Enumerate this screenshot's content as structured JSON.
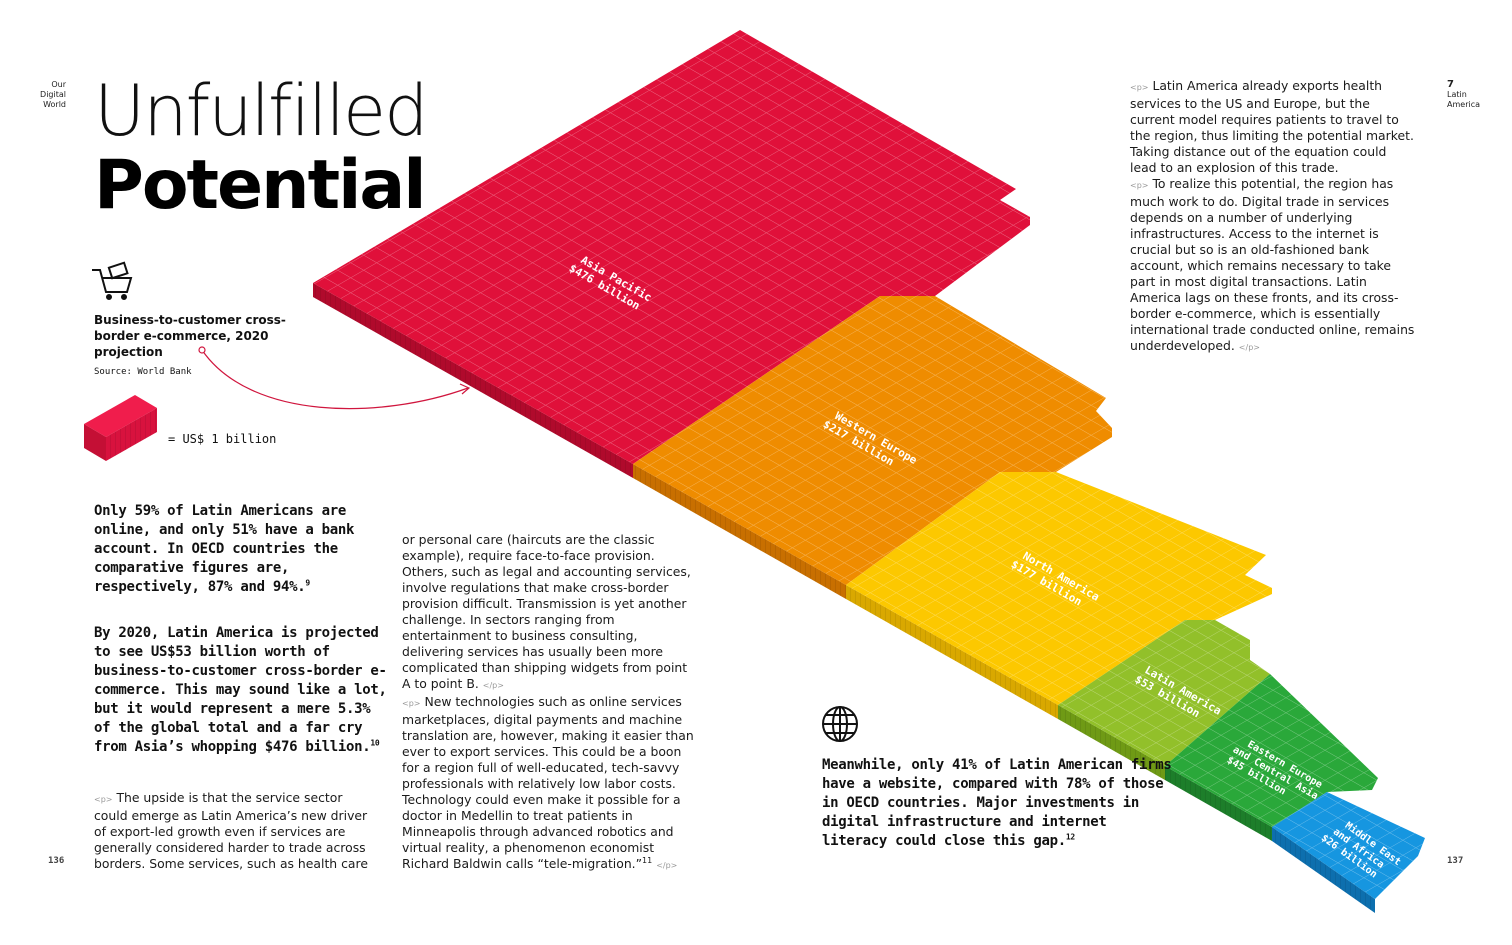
{
  "header": {
    "left_label": "Our\nDigital\nWorld",
    "right_number": "7",
    "right_label": "Latin\nAmerica"
  },
  "title": {
    "line1": "Unfulfilled",
    "line2": "Potential"
  },
  "chart_caption": {
    "title": "Business-to-customer cross-border e-commerce, 2020 projection",
    "source": "Source: World Bank",
    "legend": "= US$ 1 billion"
  },
  "callouts": {
    "c1": "Only 59% of Latin Americans are online, and only 51% have a bank account. In OECD countries the comparative figures are, respectively, 87% and 94%.",
    "c1_ref": "9",
    "c2": "By 2020, Latin America is projected to see US$53 billion worth of business-to-customer cross-border e-commerce. This may sound like a lot, but it would represent a mere 5.3% of the global total and a far cry from Asia’s whopping $476 billion.",
    "c2_ref": "10",
    "c3": "Meanwhile, only 41% of Latin American firms have a website, compared with 78% of those in OECD countries. Major investments in digital infrastructure and internet literacy could close this gap.",
    "c3_ref": "12"
  },
  "body": {
    "open_tag": "<p>",
    "close_tag": "</p>",
    "col1": "The upside is that the service sector could emerge as Latin America’s new driver of export-led growth even if services are generally considered harder to trade across borders. Some services, such as health care",
    "col2_p1": "or personal care (haircuts are the classic example), require face-to-face provision. Others, such as legal and accounting services, involve regulations that make cross-border provision difficult. Transmission is yet another challenge. In sectors ranging from entertainment to business consulting, delivering services has usually been more complicated than shipping widgets from point A to point B.",
    "col2_p2": "New technologies such as online services marketplaces, digital payments and machine translation are, however, making it easier than ever to export services. This could be a boon for a region full of well-educated, tech-savvy professionals with relatively low labor costs. Technology could even make it possible for a doctor in Medellin to treat patients in Minneapolis through advanced robotics and virtual reality, a phenomenon economist Richard Baldwin calls “tele-migration.”",
    "col2_ref": "11",
    "col3_p1": "Latin America already exports health services to the US and Europe, but the current model requires patients to travel to the region, thus limiting the potential market. Taking distance out of the equation could lead to an explosion of this trade.",
    "col3_p2": "To realize this potential, the region has much work to do. Digital trade in services depends on a number of underlying infrastructures. Access to the internet is crucial but so is an old-fashioned bank account, which remains necessary to take part in most digital transactions. Latin America lags on these fronts, and its cross-border e-commerce, which is essentially international trade conducted online, remains underdeveloped."
  },
  "pages": {
    "left": "136",
    "right": "137"
  },
  "colors": {
    "asia": "#e0103a",
    "europe": "#ef8c00",
    "north_america": "#fcc800",
    "latam": "#92c02a",
    "eeca": "#2aa83a",
    "mea": "#1696e0"
  },
  "chart_data": {
    "type": "bar",
    "title": "Business-to-customer cross-border e-commerce, 2020 projection",
    "unit": "US$ billion",
    "categories": [
      "Asia Pacific",
      "Western Europe",
      "North America",
      "Latin America",
      "Eastern Europe and Central Asia",
      "Middle East and Africa"
    ],
    "values": [
      476,
      217,
      177,
      53,
      45,
      26
    ],
    "value_labels": [
      "$476 billion",
      "$217 billion",
      "$177 billion",
      "$53 billion",
      "$45 billion",
      "$26 billion"
    ]
  }
}
